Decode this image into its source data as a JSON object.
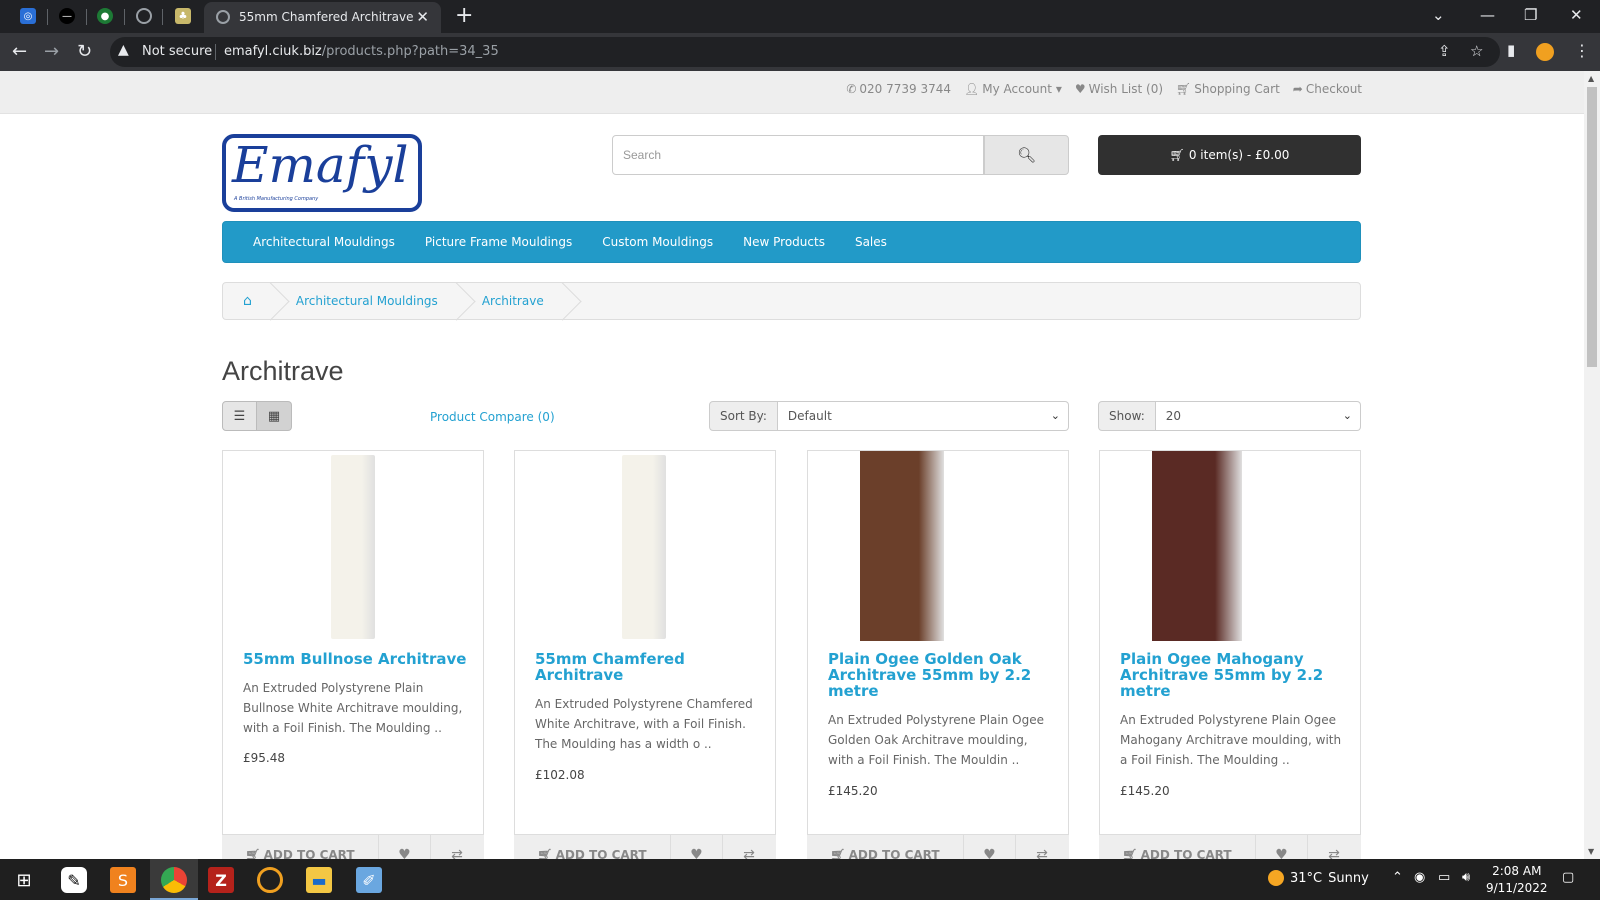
{
  "browser": {
    "tab_title": "55mm Chamfered Architrave",
    "security_label": "Not secure",
    "url_host": "emafyl.ciuk.biz",
    "url_path": "/products.php?path=34_35"
  },
  "topbar": {
    "phone": "020 7739 3744",
    "my_account": "My Account",
    "wish_list": "Wish List (0)",
    "shopping_cart": "Shopping Cart",
    "checkout": "Checkout"
  },
  "header": {
    "logo_text": "Emafyl",
    "logo_tagline": "A British Manufacturing Company",
    "search_placeholder": "Search",
    "cart_summary": "0 item(s) - £0.00"
  },
  "menu": {
    "items": [
      {
        "label": "Architectural Mouldings"
      },
      {
        "label": "Picture Frame Mouldings"
      },
      {
        "label": "Custom Mouldings"
      },
      {
        "label": "New Products"
      },
      {
        "label": "Sales"
      }
    ]
  },
  "breadcrumb": {
    "items": [
      {
        "label": "Architectural Mouldings"
      },
      {
        "label": "Architrave"
      }
    ]
  },
  "page": {
    "title": "Architrave",
    "compare_link": "Product Compare (0)",
    "sort_label": "Sort By:",
    "sort_value": "Default",
    "show_label": "Show:",
    "show_value": "20"
  },
  "products": [
    {
      "name": "55mm Bullnose Architrave",
      "description": "An Extruded Polystyrene Plain Bullnose White Architrave moulding, with a Foil Finish. The Moulding ..",
      "price": "£95.48",
      "finish_color": "#f4f2ea",
      "add_to_cart": "ADD TO CART"
    },
    {
      "name": "55mm Chamfered Architrave",
      "description": "An Extruded Polystyrene Chamfered White Architrave, with a Foil Finish. The Moulding has a width o ..",
      "price": "£102.08",
      "finish_color": "#f4f2ea",
      "add_to_cart": "ADD TO CART"
    },
    {
      "name": "Plain Ogee Golden Oak Architrave 55mm by 2.2 metre",
      "description": "An Extruded Polystyrene Plain Ogee Golden Oak Architrave moulding, with a Foil Finish. The Mouldin ..",
      "price": "£145.20",
      "finish_color": "#6b3f2a",
      "add_to_cart": "ADD TO CART"
    },
    {
      "name": "Plain Ogee Mahogany Architrave 55mm by 2.2 metre",
      "description": "An Extruded Polystyrene Plain Ogee Mahogany Architrave moulding, with a Foil Finish. The Moulding ..",
      "price": "£145.20",
      "finish_color": "#5a2a24",
      "add_to_cart": "ADD TO CART"
    }
  ],
  "taskbar": {
    "temperature": "31°C",
    "weather": "Sunny",
    "time": "2:08 AM",
    "date": "9/11/2022"
  },
  "colors": {
    "accent": "#229ac8",
    "link": "#23a1d1",
    "logo_blue": "#1a3f9a",
    "cart_button": "#303030"
  }
}
